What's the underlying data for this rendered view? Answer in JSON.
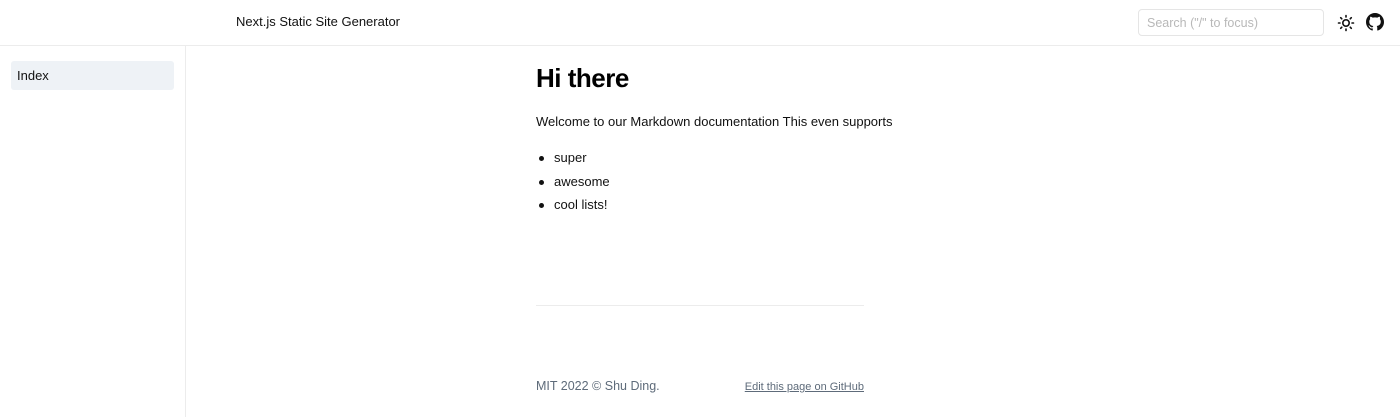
{
  "header": {
    "site_title": "Next.js Static Site Generator",
    "search_placeholder": "Search (\"/\" to focus)",
    "theme_icon": "sun-icon",
    "github_icon": "github-icon"
  },
  "sidebar": {
    "items": [
      {
        "label": "Index",
        "active": true
      }
    ]
  },
  "main": {
    "title": "Hi there",
    "intro": "Welcome to our Markdown documentation This even supports",
    "list": [
      "super",
      "awesome",
      "cool lists!"
    ]
  },
  "footer": {
    "copyright": "MIT 2022 © Shu Ding.",
    "edit_link": "Edit this page on GitHub"
  },
  "colors": {
    "sidebar_active_bg": "#eef2f6",
    "border": "#ececec",
    "footer_text": "#5e6b7a"
  }
}
